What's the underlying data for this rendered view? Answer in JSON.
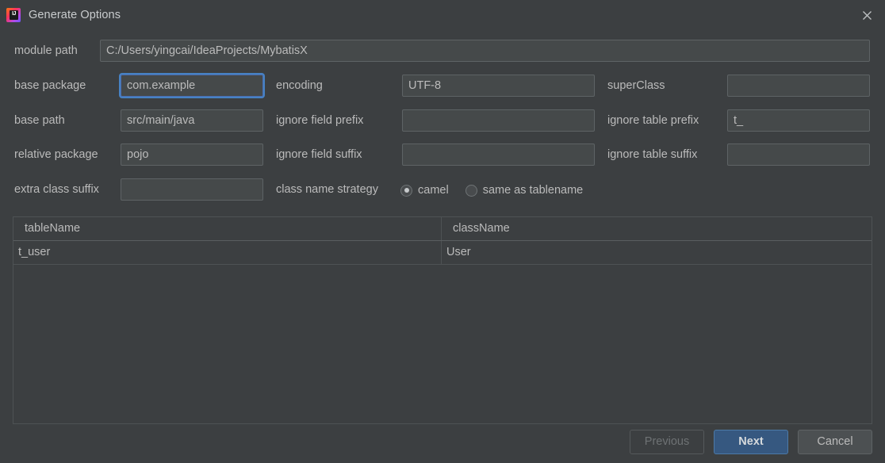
{
  "window": {
    "title": "Generate Options",
    "app_icon": "intellij-idea-icon",
    "icon_text": "IJ",
    "close_icon": "close-icon"
  },
  "form": {
    "module_path": {
      "label": "module path",
      "value": "C:/Users/yingcai/IdeaProjects/MybatisX"
    },
    "base_package": {
      "label": "base package",
      "value": "com.example",
      "focused": true
    },
    "encoding": {
      "label": "encoding",
      "value": "UTF-8"
    },
    "super_class": {
      "label": "superClass",
      "value": ""
    },
    "base_path": {
      "label": "base path",
      "value": "src/main/java"
    },
    "ignore_field_prefix": {
      "label": "ignore field prefix",
      "value": ""
    },
    "ignore_table_prefix": {
      "label": "ignore table prefix",
      "value": "t_"
    },
    "relative_package": {
      "label": "relative package",
      "value": "pojo"
    },
    "ignore_field_suffix": {
      "label": "ignore field suffix",
      "value": ""
    },
    "ignore_table_suffix": {
      "label": "ignore table suffix",
      "value": ""
    },
    "extra_class_suffix": {
      "label": "extra class suffix",
      "value": ""
    },
    "class_name_strategy": {
      "label": "class name strategy",
      "options": [
        {
          "label": "camel",
          "selected": true
        },
        {
          "label": "same as tablename",
          "selected": false
        }
      ]
    }
  },
  "table": {
    "columns": [
      "tableName",
      "className"
    ],
    "rows": [
      {
        "tableName": "t_user",
        "className": "User"
      }
    ]
  },
  "footer": {
    "previous_label": "Previous",
    "previous_disabled": true,
    "next_label": "Next",
    "cancel_label": "Cancel"
  },
  "colors": {
    "dialog_bg": "#3C3F41",
    "field_bg": "#45494A",
    "text": "#BBBBBB",
    "focus_ring": "#4782C4",
    "primary_button": "#365880"
  }
}
